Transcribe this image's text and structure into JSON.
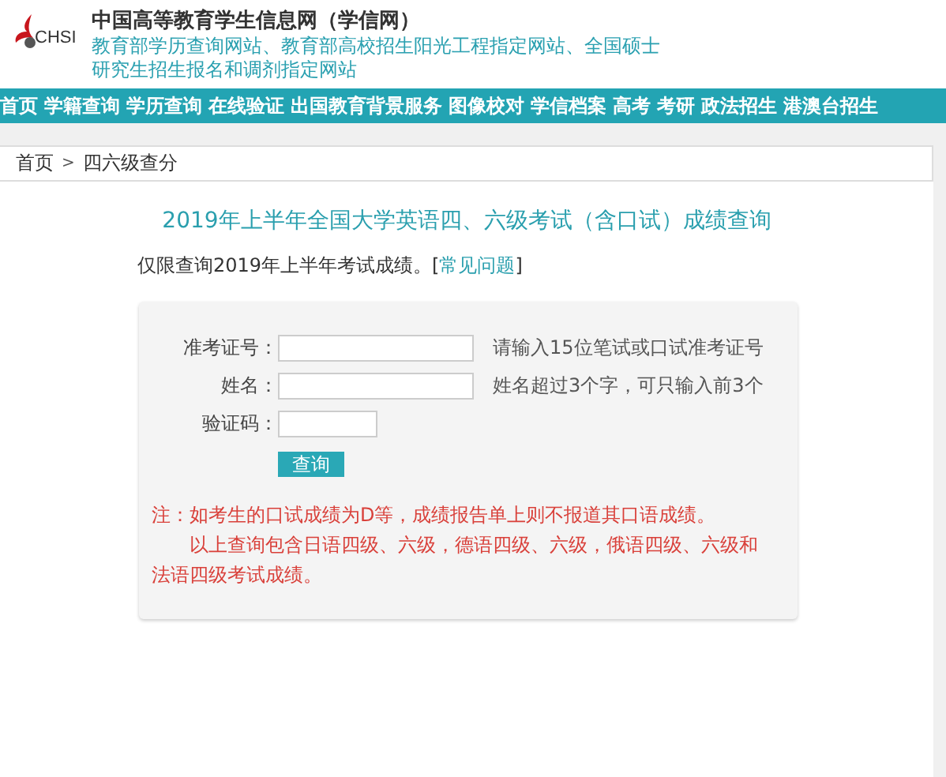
{
  "header": {
    "logo_text": "CHSI",
    "site_title": "中国高等教育学生信息网（学信网）",
    "subtitle_lines": [
      "教育部学历查询网站、教育部高校招生阳光工程指定网站、全国硕士",
      "研究生招生报名和调剂指定网站"
    ]
  },
  "nav": [
    {
      "label": "首页"
    },
    {
      "label": "学籍查询"
    },
    {
      "label": "学历查询"
    },
    {
      "label": "在线验证"
    },
    {
      "label": "出国教育背景服务"
    },
    {
      "label": "图像校对"
    },
    {
      "label": "学信档案"
    },
    {
      "label": "高考"
    },
    {
      "label": "考研"
    },
    {
      "label": "政法招生"
    },
    {
      "label": "港澳台招生"
    }
  ],
  "breadcrumb": {
    "items": [
      "首页",
      "四六级查分"
    ],
    "separator": ">"
  },
  "page_title": "2019年上半年全国大学英语四、六级考试（含口试）成绩查询",
  "intro": {
    "text": "仅限查询2019年上半年考试成绩。[",
    "link": "常见问题",
    "after": "]"
  },
  "form": {
    "fields": [
      {
        "label": "准考证号：",
        "kind": "long",
        "hint": "请输入15位笔试或口试准考证号"
      },
      {
        "label": "姓名：",
        "kind": "long",
        "hint": "姓名超过3个字，可只输入前3个"
      },
      {
        "label": "验证码：",
        "kind": "short"
      }
    ],
    "submit": "查询",
    "notes": [
      "注：如考生的口试成绩为D等，成绩报告单上则不报道其口语成绩。",
      "以上查询包含日语四级、六级，德语四级、六级，俄语四级、六级和法语四级考试成绩。"
    ]
  }
}
